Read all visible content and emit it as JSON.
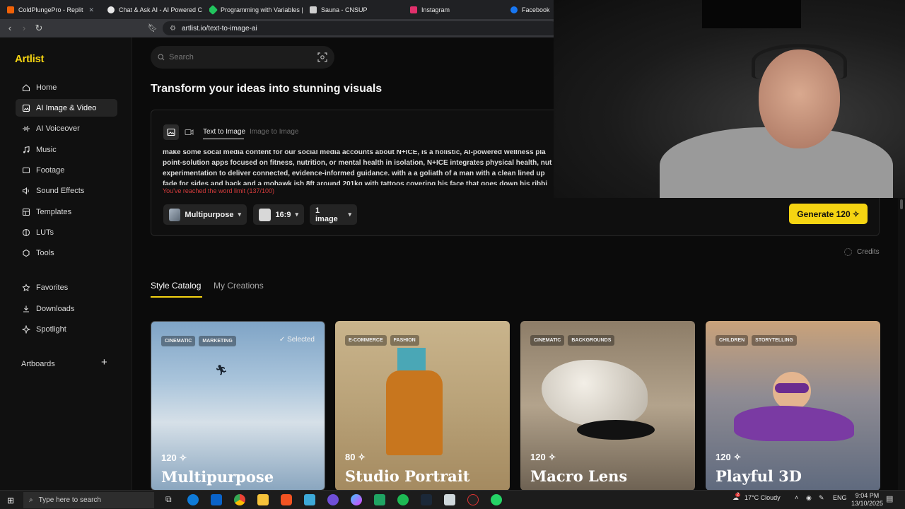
{
  "browser": {
    "tabs": [
      {
        "label": "ColdPlungePro - Replit",
        "color": "#f26207"
      },
      {
        "label": "Chat & Ask AI - AI Powered Ch",
        "color": "#e8e8e8"
      },
      {
        "label": "Programming with Variables | I",
        "color": "#22c55e"
      },
      {
        "label": "Sauna - CNSUP",
        "color": "#cfcfcf"
      },
      {
        "label": "Instagram",
        "color": "#e1306c"
      },
      {
        "label": "Facebook",
        "color": "#1877f2"
      }
    ],
    "url": "artlist.io/text-to-image-ai"
  },
  "sidebar": {
    "logo": "Artlist",
    "items": [
      {
        "label": "Home",
        "icon": "home-icon"
      },
      {
        "label": "AI Image & Video",
        "icon": "ai-image-icon"
      },
      {
        "label": "AI Voiceover",
        "icon": "waveform-icon"
      },
      {
        "label": "Music",
        "icon": "music-icon"
      },
      {
        "label": "Footage",
        "icon": "film-icon"
      },
      {
        "label": "Sound Effects",
        "icon": "sound-icon"
      },
      {
        "label": "Templates",
        "icon": "templates-icon"
      },
      {
        "label": "LUTs",
        "icon": "lut-icon"
      },
      {
        "label": "Tools",
        "icon": "tools-icon"
      },
      {
        "label": "Favorites",
        "icon": "star-icon"
      },
      {
        "label": "Downloads",
        "icon": "download-icon"
      },
      {
        "label": "Spotlight",
        "icon": "spotlight-icon"
      }
    ],
    "artboards_label": "Artboards"
  },
  "search": {
    "placeholder": "Search"
  },
  "main": {
    "heading": "Transform your ideas into stunning visuals",
    "subtabs": {
      "text_to_image": "Text to Image",
      "image_to_image": "Image to Image"
    },
    "prompt_lines": [
      "make some socal media content for our social media accounts about N+ICE, is a holistic, AI-powered wellness pla",
      "point-solution apps focused on fitness, nutrition, or mental health in isolation, N+ICE integrates physical health, nut",
      "experimentation to deliver connected, evidence-informed guidance. with a a goliath of a man with a clean lined up",
      "fade for sides and back and a mohawk ish 8ft around 201kg with tattoos covering his face that goes down his ribbi"
    ],
    "word_limit_warning": "You've reached the word limit (137/100)",
    "options": {
      "style": "Multipurpose",
      "ratio": "16:9",
      "count": "1 image"
    },
    "generate_label": "Generate 120",
    "credits_label": "Credits",
    "catalog_tabs": {
      "style_catalog": "Style Catalog",
      "my_creations": "My Creations"
    },
    "cards": [
      {
        "tags": [
          "CINEMATIC",
          "MARKETING"
        ],
        "price": "120",
        "title": "Multipurpose",
        "selected": "Selected"
      },
      {
        "tags": [
          "E-COMMERCE",
          "FASHION"
        ],
        "price": "80",
        "title": "Studio Portrait"
      },
      {
        "tags": [
          "CINEMATIC",
          "BACKGROUNDS"
        ],
        "price": "120",
        "title": "Macro Lens"
      },
      {
        "tags": [
          "CHILDREN",
          "STORYTELLING"
        ],
        "price": "120",
        "title": "Playful 3D"
      }
    ]
  },
  "taskbar": {
    "search_placeholder": "Type here to search",
    "weather": "17°C  Cloudy",
    "lang": "ENG",
    "time": "9:04 PM",
    "date": "13/10/2025",
    "notification_count": "2"
  },
  "colors": {
    "accent": "#f5d412",
    "warning": "#d23b3b"
  }
}
